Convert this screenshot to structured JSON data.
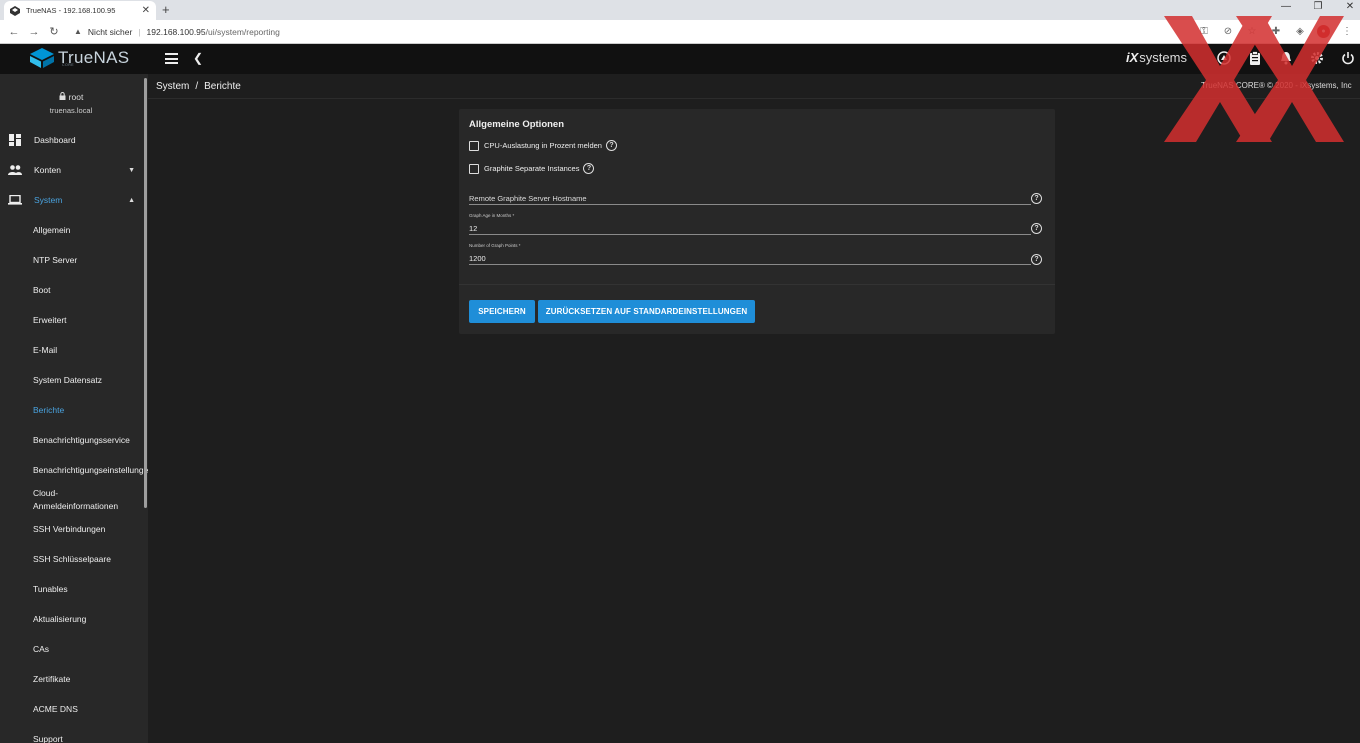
{
  "browser": {
    "tab_title": "TrueNAS - 192.168.100.95",
    "security_label": "Nicht sicher",
    "url_host": "192.168.100.95",
    "url_path": "/ui/system/reporting"
  },
  "app": {
    "logo_text": "TrueNAS",
    "logo_sub": "CORE",
    "vendor_logo_badge": "iX",
    "vendor_logo_text": "systems",
    "copyright": "TrueNAS CORE® © 2020 - iXsystems, Inc"
  },
  "user": {
    "name": "root",
    "host": "truenas.local"
  },
  "nav": {
    "dashboard": "Dashboard",
    "accounts": "Konten",
    "system": "System",
    "system_items": [
      "Allgemein",
      "NTP Server",
      "Boot",
      "Erweitert",
      "E-Mail",
      "System Datensatz",
      "Berichte",
      "Benachrichtigungsservice",
      "Benachrichtigungseinstellungen",
      "Cloud-",
      "Anmeldeinformationen",
      "SSH Verbindungen",
      "SSH Schlüsselpaare",
      "Tunables",
      "Aktualisierung",
      "CAs",
      "Zertifikate",
      "ACME DNS",
      "Support"
    ]
  },
  "breadcrumb": {
    "parent": "System",
    "separator": "/",
    "current": "Berichte"
  },
  "form": {
    "title": "Allgemeine Optionen",
    "cpu_checkbox_label": "CPU-Auslastung in Prozent melden",
    "graphite_checkbox_label": "Graphite Separate Instances",
    "hostname_placeholder": "Remote Graphite Server Hostname",
    "graph_age_label": "Graph Age in Months *",
    "graph_age_value": "12",
    "graph_points_label": "Number of Graph Points *",
    "graph_points_value": "1200",
    "save_button": "SPEICHERN",
    "reset_button": "ZURÜCKSETZEN AUF STANDARDEINSTELLUNGEN"
  },
  "colors": {
    "accent": "#1f8ed8",
    "active_nav": "#4aa3df",
    "topbar": "#111111",
    "sidebar": "#282828",
    "watermark": "#d32f2f"
  }
}
